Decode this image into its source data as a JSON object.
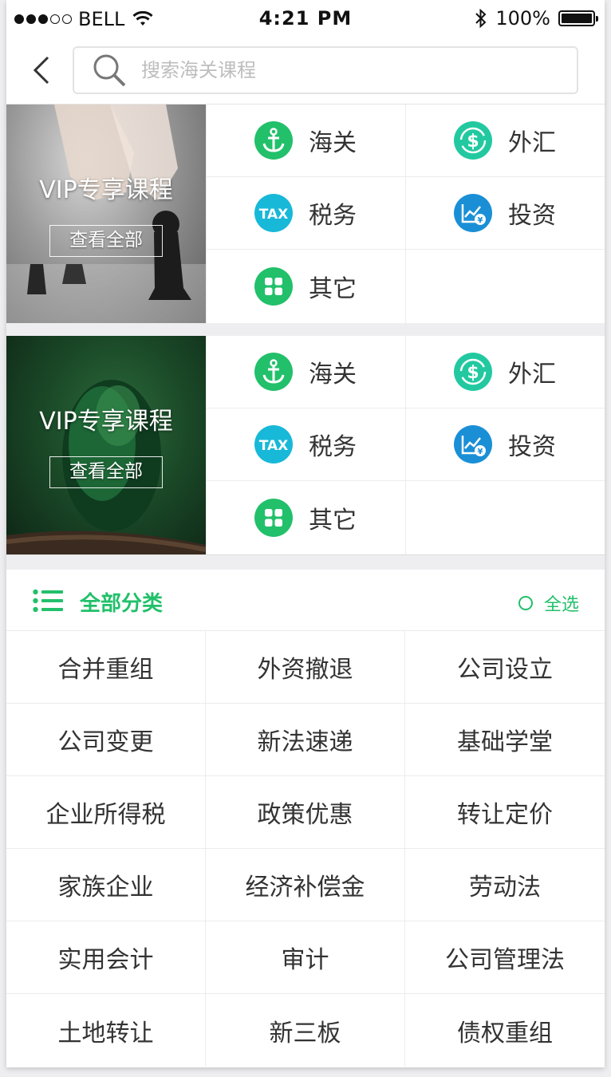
{
  "status_bar": {
    "carrier": "BELL",
    "time": "4:21 PM",
    "battery": "100%"
  },
  "search": {
    "placeholder": "搜索海关课程"
  },
  "vip_blocks": [
    {
      "title": "VIP专享课程",
      "button": "查看全部",
      "categories": [
        {
          "label": "海关",
          "icon": "anchor-icon",
          "color": "#22c06a"
        },
        {
          "label": "外汇",
          "icon": "dollar-exchange-icon",
          "color": "#22c9a0"
        },
        {
          "label": "税务",
          "icon": "tax-icon",
          "color": "#18b8d8"
        },
        {
          "label": "投资",
          "icon": "investment-chart-icon",
          "color": "#1a8fd6"
        },
        {
          "label": "其它",
          "icon": "grid-icon",
          "color": "#22c06a"
        }
      ]
    },
    {
      "title": "VIP专享课程",
      "button": "查看全部",
      "categories": [
        {
          "label": "海关",
          "icon": "anchor-icon",
          "color": "#22c06a"
        },
        {
          "label": "外汇",
          "icon": "dollar-exchange-icon",
          "color": "#22c9a0"
        },
        {
          "label": "税务",
          "icon": "tax-icon",
          "color": "#18b8d8"
        },
        {
          "label": "投资",
          "icon": "investment-chart-icon",
          "color": "#1a8fd6"
        },
        {
          "label": "其它",
          "icon": "grid-icon",
          "color": "#22c06a"
        }
      ]
    }
  ],
  "all_categories": {
    "title": "全部分类",
    "select_all": "全选",
    "accent": "#22c06a",
    "tags": [
      "合并重组",
      "外资撤退",
      "公司设立",
      "公司变更",
      "新法速递",
      "基础学堂",
      "企业所得税",
      "政策优惠",
      "转让定价",
      "家族企业",
      "经济补偿金",
      "劳动法",
      "实用会计",
      "审计",
      "公司管理法",
      "土地转让",
      "新三板",
      "债权重组"
    ]
  }
}
